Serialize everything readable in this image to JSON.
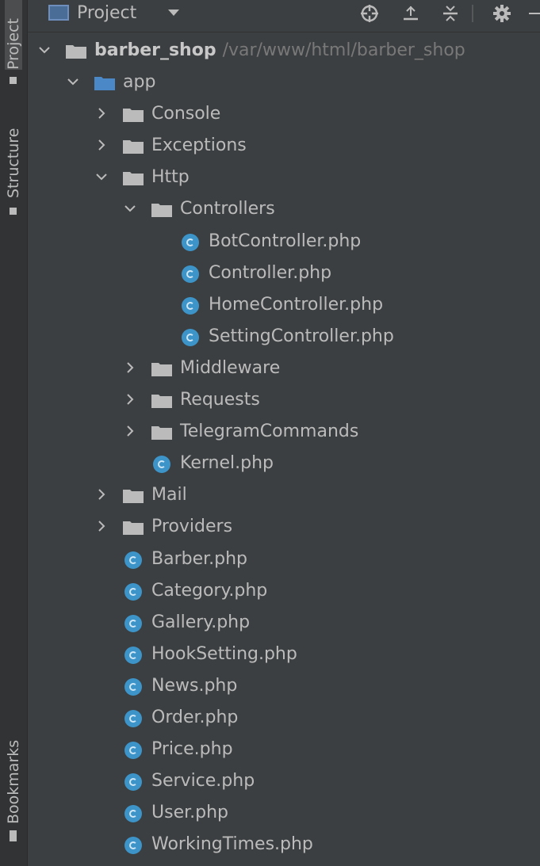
{
  "side_tabs": {
    "project": "Project",
    "structure": "Structure",
    "bookmarks": "Bookmarks"
  },
  "header": {
    "title": "Project"
  },
  "root": {
    "name": "barber_shop",
    "path": "/var/www/html/barber_shop"
  },
  "tree": {
    "app": "app",
    "console": "Console",
    "exceptions": "Exceptions",
    "http": "Http",
    "controllers": "Controllers",
    "bot_controller": "BotController.php",
    "controller": "Controller.php",
    "home_controller": "HomeController.php",
    "setting_controller": "SettingController.php",
    "middleware": "Middleware",
    "requests": "Requests",
    "telegram_commands": "TelegramCommands",
    "kernel": "Kernel.php",
    "mail": "Mail",
    "providers": "Providers",
    "barber": "Barber.php",
    "category": "Category.php",
    "gallery": "Gallery.php",
    "hook_setting": "HookSetting.php",
    "news": "News.php",
    "order": "Order.php",
    "price": "Price.php",
    "service": "Service.php",
    "user": "User.php",
    "working_times": "WorkingTimes.php"
  },
  "colors": {
    "background": "#3c3f41",
    "text": "#bbbbbb",
    "path_text": "#787878",
    "class_icon": "#3d94c9",
    "module_folder": "#4a88c7",
    "folder": "#bbbbbb"
  },
  "icons": {
    "locate": "crosshair-icon",
    "expand_all": "expand-all-icon",
    "collapse_all": "collapse-all-icon",
    "settings": "gear-icon"
  }
}
